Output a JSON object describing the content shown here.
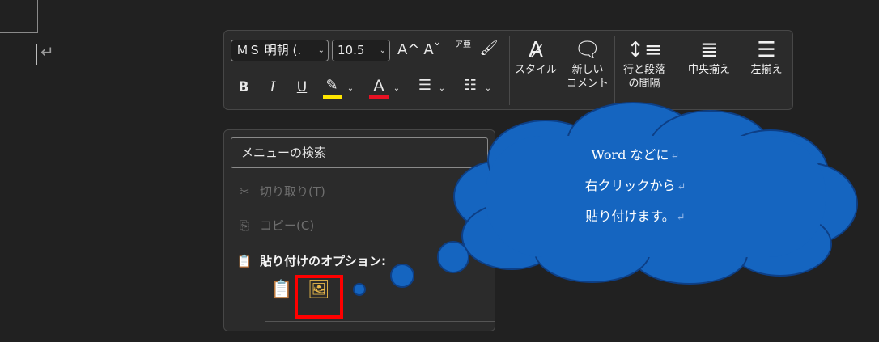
{
  "document": {
    "paragraph_mark": "↵"
  },
  "toolbar": {
    "font_name": "ＭＳ 明朝 (.",
    "font_size": "10.5",
    "grow_font": "A^",
    "shrink_font": "Aˇ",
    "phonetic": "ア亜",
    "bold": "B",
    "italic": "I",
    "underline": "U",
    "font_color": "A",
    "highlight_color": "#ffe600",
    "font_color_bar": "#e81123",
    "styles_label": "スタイル",
    "new_comment_label_1": "新しい",
    "new_comment_label_2": "コメント",
    "line_spacing_label_1": "行と段落",
    "line_spacing_label_2": "の間隔",
    "center_label": "中央揃え",
    "left_label": "左揃え"
  },
  "menu": {
    "search_placeholder": "メニューの検索",
    "items": [
      {
        "label": "切り取り(T)",
        "icon": "scissors-icon",
        "disabled": true
      },
      {
        "label": "コピー(C)",
        "icon": "copy-icon",
        "disabled": true
      },
      {
        "label": "貼り付けのオプション:",
        "icon": "paste-icon",
        "disabled": false
      }
    ],
    "paste_options": [
      "keep-source-formatting-icon",
      "paste-as-picture-icon"
    ]
  },
  "callout": {
    "line1": "Word などに",
    "line2": "右クリックから",
    "line3": "貼り付けます。",
    "pm": "↵",
    "color": "#1565c0"
  }
}
